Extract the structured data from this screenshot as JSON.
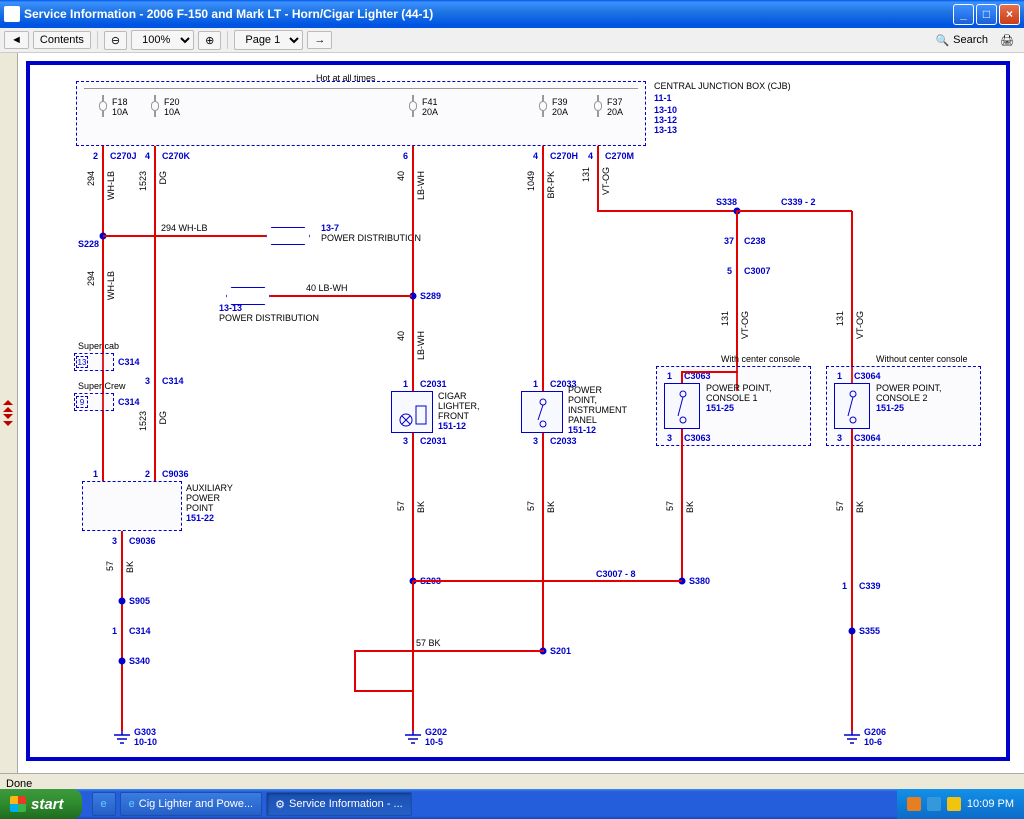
{
  "window": {
    "title": "Service Information - 2006 F-150 and Mark LT - Horn/Cigar Lighter (44-1)"
  },
  "toolbar": {
    "contents": "Contents",
    "zoom_out": "⊖",
    "zoom": "100%",
    "zoom_in": "⊕",
    "page": "Page 1",
    "search": "Search"
  },
  "diagram": {
    "hot_label": "Hot at all times",
    "cjb": {
      "title": "CENTRAL JUNCTION BOX (CJB)",
      "ref": "11-1",
      "notes": [
        "13-10",
        "13-12",
        "13-13"
      ]
    },
    "fuses": {
      "f18": {
        "name": "F18",
        "rating": "10A"
      },
      "f20": {
        "name": "F20",
        "rating": "10A"
      },
      "f41": {
        "name": "F41",
        "rating": "20A"
      },
      "f39": {
        "name": "F39",
        "rating": "20A"
      },
      "f37": {
        "name": "F37",
        "rating": "20A"
      }
    },
    "connectors": {
      "c270j_pin": "2",
      "c270j": "C270J",
      "c270k_pin": "4",
      "c270k": "C270K",
      "c270h_pin1": "6",
      "c270h_pin2": "4",
      "c270h": "C270H",
      "c270m_pin": "4",
      "c270m": "C270M",
      "c314a_pin": "13",
      "c314a": "C314",
      "c314a_note": "Super cab",
      "c314b_pin": "9",
      "c314b": "C314",
      "c314b_note": "Super Crew",
      "c314c_pin": "3",
      "c314c": "C314",
      "c9036_pin": "2",
      "c9036": "C9036",
      "c9036b_pin": "3",
      "c9036b": "C9036",
      "c2031_pin": "1",
      "c2031": "C2031",
      "c2031b_pin": "3",
      "c2031b": "C2031",
      "c2033_pin": "1",
      "c2033": "C2033",
      "c2033b_pin": "3",
      "c2033b": "C2033",
      "c3063_pin": "1",
      "c3063": "C3063",
      "c3063b_pin": "3",
      "c3063b": "C3063",
      "c3064_pin": "1",
      "c3064": "C3064",
      "c3064b_pin": "3",
      "c3064b": "C3064",
      "c238_pin": "37",
      "c238": "C238",
      "c3007_pin": "5",
      "c3007": "C3007",
      "c339_pin": "1",
      "c339": "C339",
      "c314d_pin": "1",
      "c314d": "C314"
    },
    "splices": {
      "s228": "S228",
      "s289": "S289",
      "s338": "S338",
      "s203": "S203",
      "s380": "S380",
      "s201": "S201",
      "s905": "S905",
      "s340": "S340",
      "s355": "S355",
      "c339_2": "C339 - 2",
      "c3007_8": "C3007 - 8"
    },
    "wires": {
      "w294": "294",
      "wh_lb": "WH-LB",
      "w1523": "1523",
      "dg": "DG",
      "w40": "40",
      "lb_wh": "LB-WH",
      "w1049": "1049",
      "br_pk": "BR-PK",
      "w131": "131",
      "vt_og": "VT-OG",
      "w57": "57",
      "bk": "BK",
      "pd_294": "294   WH-LB",
      "pd_40": "40   LB-WH",
      "bk_57": "57   BK"
    },
    "refs": {
      "pd1": "13-7",
      "pd1_label": "POWER DISTRIBUTION",
      "pd2": "13-13",
      "pd2_label": "POWER DISTRIBUTION"
    },
    "components": {
      "aux": {
        "title": "AUXILIARY POWER POINT",
        "ref": "151-22",
        "pin1": "1"
      },
      "cigar": {
        "title": "CIGAR LIGHTER, FRONT",
        "ref": "151-12"
      },
      "pp_ip": {
        "title": "POWER POINT, INSTRUMENT PANEL",
        "ref": "151-12"
      },
      "pp_c1": {
        "title": "POWER POINT, CONSOLE 1",
        "ref": "151-25",
        "note": "With center console"
      },
      "pp_c2": {
        "title": "POWER POINT, CONSOLE 2",
        "ref": "151-25",
        "note": "Without center console"
      }
    },
    "grounds": {
      "g303": {
        "name": "G303",
        "ref": "10-10"
      },
      "g202": {
        "name": "G202",
        "ref": "10-5"
      },
      "g206": {
        "name": "G206",
        "ref": "10-6"
      }
    }
  },
  "status": {
    "text": "Done"
  },
  "taskbar": {
    "start": "start",
    "task1": "Cig Lighter and Powe...",
    "task2": "Service Information - ...",
    "time": "10:09 PM"
  }
}
